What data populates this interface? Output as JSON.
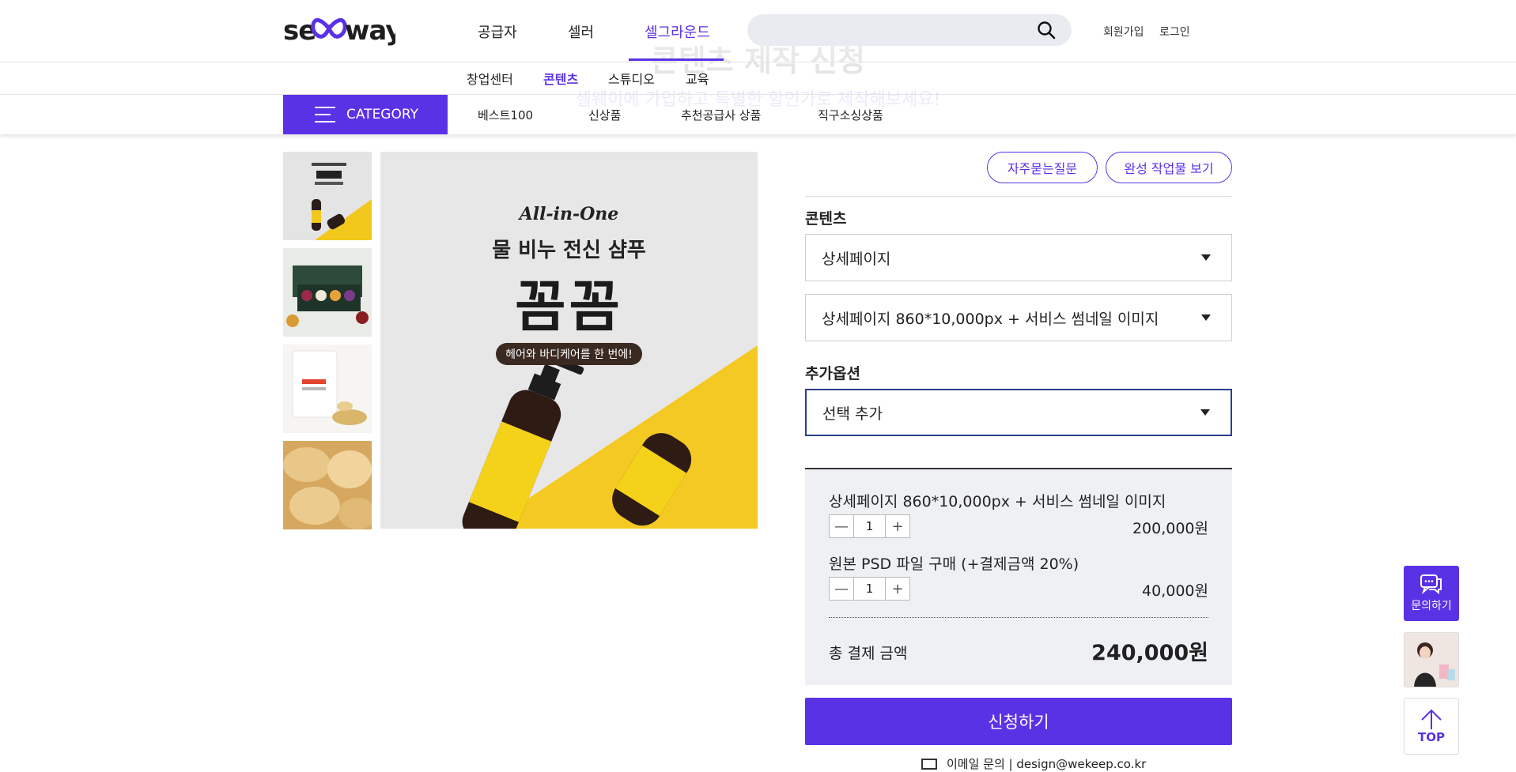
{
  "header": {
    "logo": "sellway",
    "nav": [
      "공급자",
      "셀러",
      "셀그라운드"
    ],
    "active_nav": "셀그라운드",
    "search": {
      "placeholder": ""
    },
    "signup": "회원가입",
    "login": "로그인"
  },
  "page_header": {
    "title": "콘텐츠 제작 신청",
    "subtitle": "셀웨이에 가입하고 특별한 할인가로 제작해보세요!"
  },
  "sub_nav": [
    "창업센터",
    "콘텐츠",
    "스튜디오",
    "교육"
  ],
  "category_bar": {
    "button": "CATEGORY",
    "links": [
      "베스트100",
      "신상품",
      "추천공급사 상품",
      "직구소싱상품"
    ]
  },
  "product_image": {
    "tagline": "All-in-One",
    "headline": "물 비누 전신 샴푸",
    "brand": "꼼꼼",
    "badge": "헤어와 바디케어를 한 번에!"
  },
  "form": {
    "faq_button": "자주묻는질문",
    "portfolio_button": "완성 작업물 보기",
    "content_label": "콘텐츠",
    "content_select": "상세페이지",
    "option_select": "상세페이지 860*10,000px + 서비스 썸네일 이미지",
    "extra_label": "추가옵션",
    "extra_select": "선택 추가",
    "items": [
      {
        "name": "상세페이지 860*10,000px + 서비스 썸네일 이미지",
        "qty": "1",
        "price": "200,000원"
      },
      {
        "name": "원본 PSD 파일 구매 (+결제금액 20%)",
        "qty": "1",
        "price": "40,000원"
      }
    ],
    "total_label": "총 결제 금액",
    "total_price": "240,000원",
    "apply_button": "신청하기",
    "email_text": "이메일 문의 | design@wekeep.co.kr"
  },
  "floating": {
    "inquiry": "문의하기",
    "top": "TOP"
  },
  "colors": {
    "accent": "#5a32e6",
    "summary_bg": "#eef0f3"
  }
}
